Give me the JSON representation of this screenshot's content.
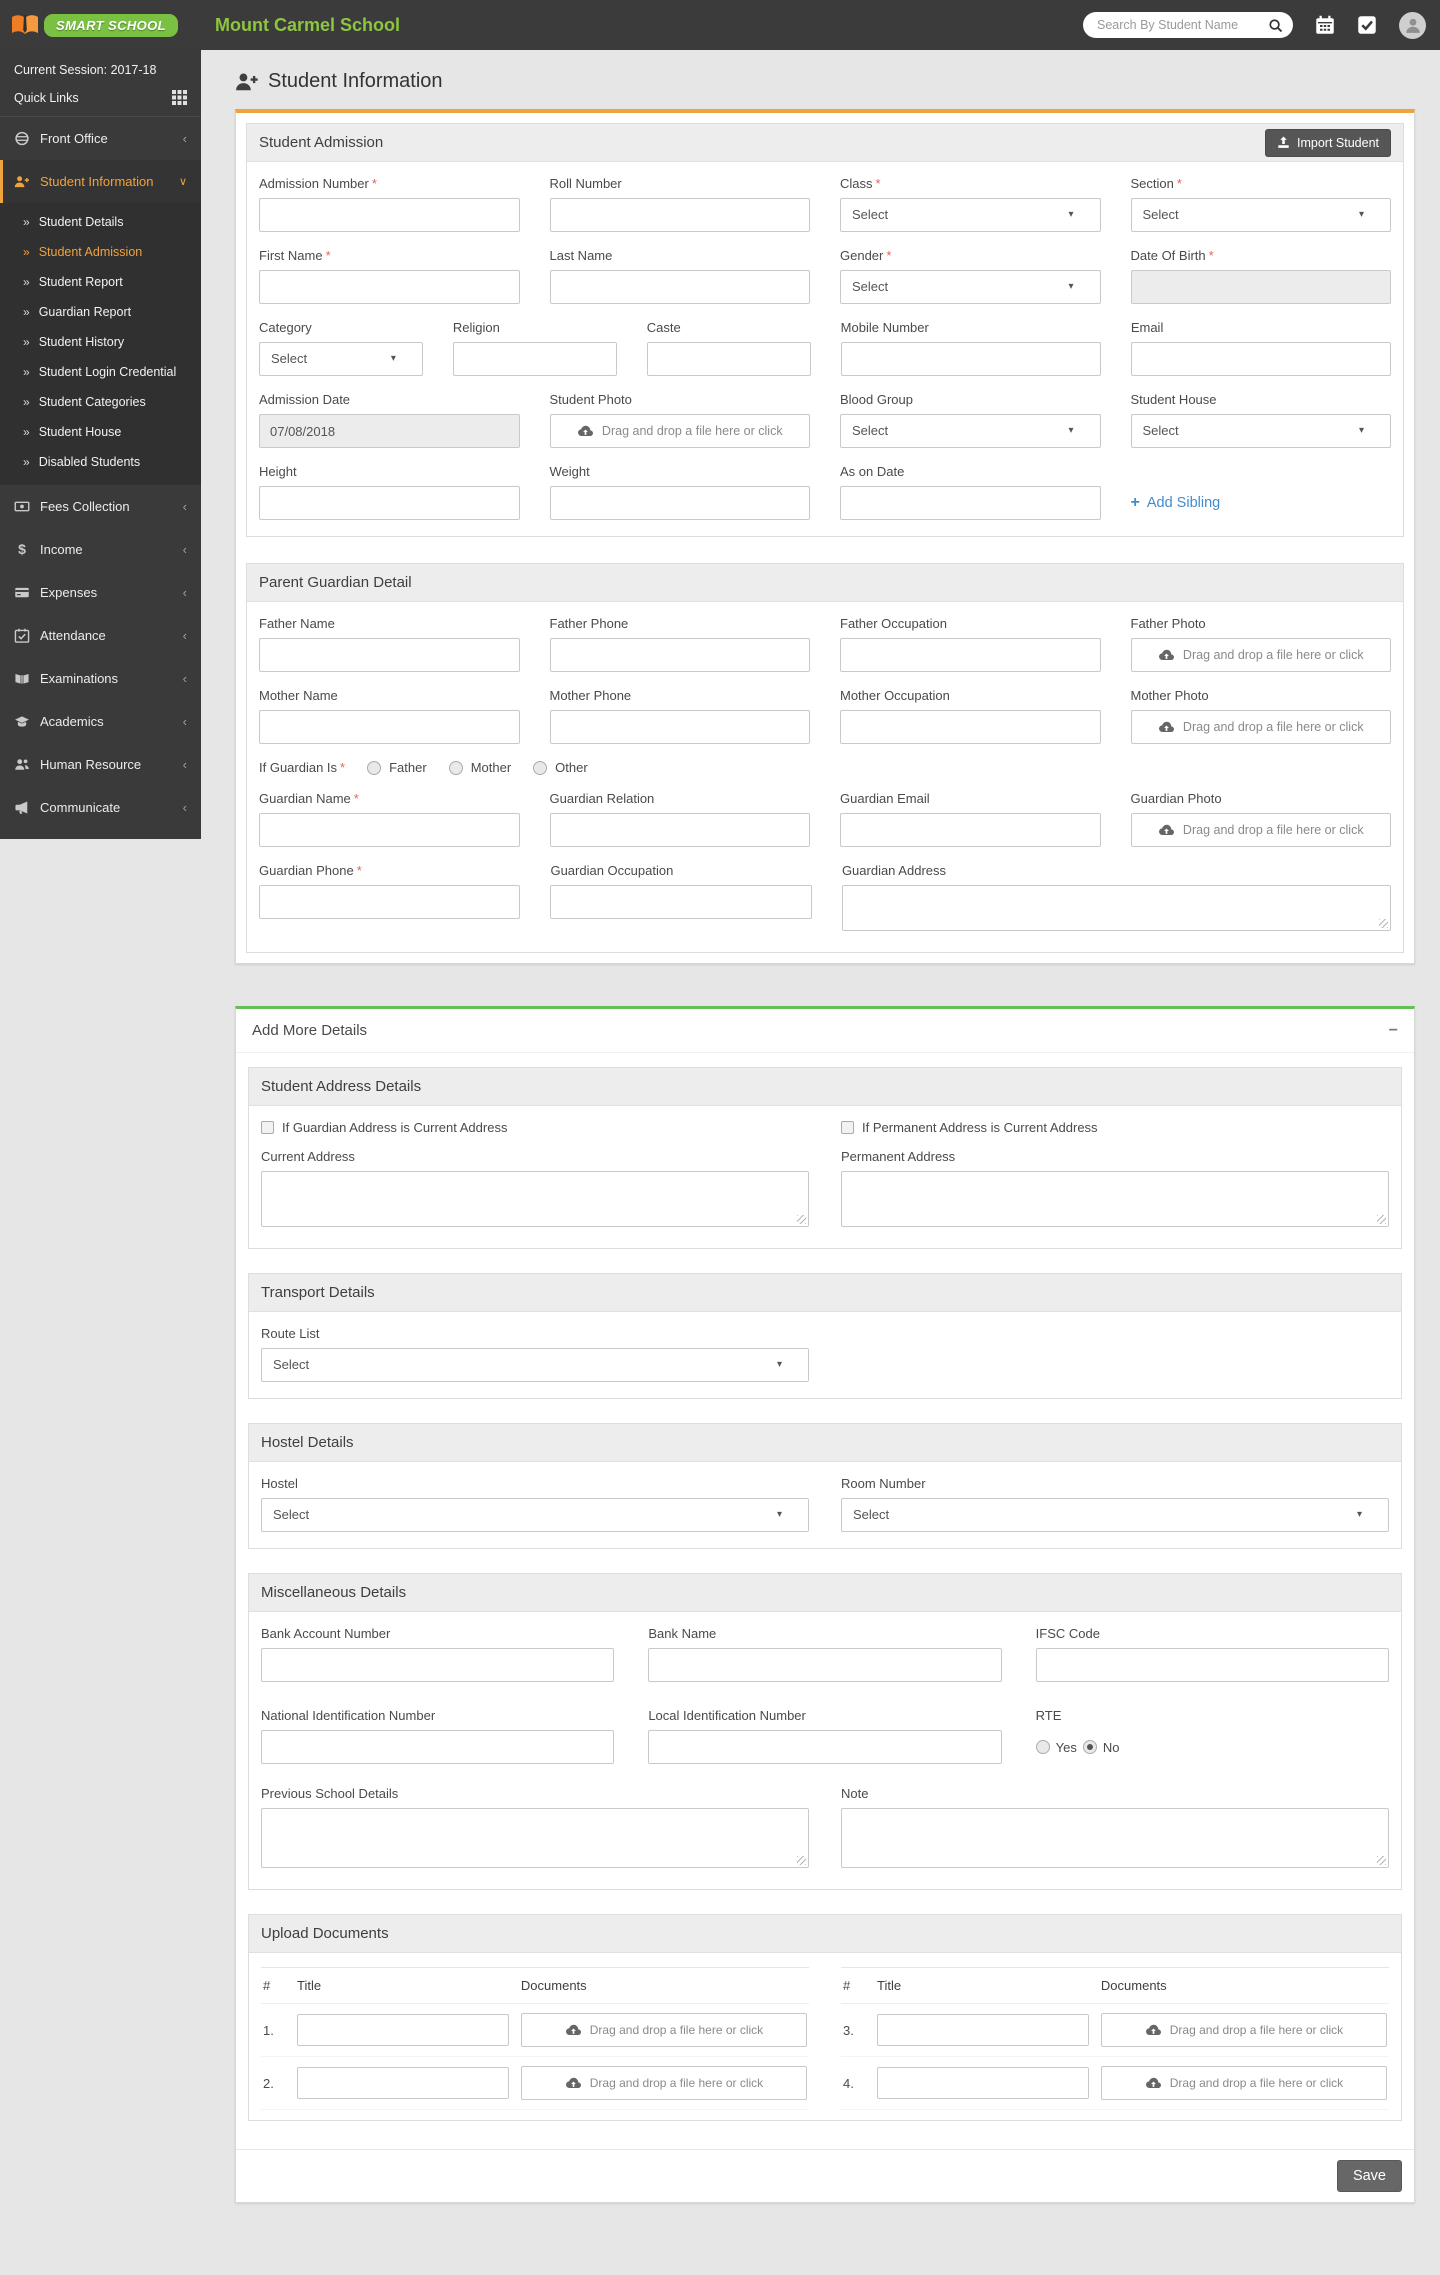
{
  "topbar": {
    "brand": "SMART SCHOOL",
    "school_name": "Mount Carmel School",
    "search_placeholder": "Search By Student Name"
  },
  "sidebar": {
    "session": "Current Session: 2017-18",
    "quick_links": "Quick Links",
    "items": [
      "Front Office",
      "Student Information",
      "Fees Collection",
      "Income",
      "Expenses",
      "Attendance",
      "Examinations",
      "Academics",
      "Human Resource",
      "Communicate"
    ],
    "sub_items": [
      "Student Details",
      "Student Admission",
      "Student Report",
      "Guardian Report",
      "Student History",
      "Student Login Credential",
      "Student Categories",
      "Student House",
      "Disabled Students"
    ],
    "active_item": "Student Information",
    "active_sub_item": "Student Admission"
  },
  "page_title": "Student Information",
  "icons": {
    "required": "*",
    "caret": "▾",
    "chevron_collapsed": "‹",
    "chevron_expanded": "∨",
    "submenu_arrow": "»",
    "collapse": "−",
    "add": "+"
  },
  "common": {
    "select_placeholder": "Select",
    "dropzone_text": "Drag and drop a file here or click"
  },
  "admission": {
    "title": "Student Admission",
    "import_label": "Import Student",
    "labels": {
      "admission_number": "Admission Number",
      "roll_number": "Roll Number",
      "class": "Class",
      "section": "Section",
      "first_name": "First Name",
      "last_name": "Last Name",
      "gender": "Gender",
      "dob": "Date Of Birth",
      "category": "Category",
      "religion": "Religion",
      "caste": "Caste",
      "mobile": "Mobile Number",
      "email": "Email",
      "admission_date": "Admission Date",
      "student_photo": "Student Photo",
      "blood_group": "Blood Group",
      "student_house": "Student House",
      "height": "Height",
      "weight": "Weight",
      "as_on_date": "As on Date",
      "add_sibling": "Add Sibling"
    },
    "values": {
      "admission_date": "07/08/2018"
    }
  },
  "guardian": {
    "title": "Parent Guardian Detail",
    "labels": {
      "father_name": "Father Name",
      "father_phone": "Father Phone",
      "father_occupation": "Father Occupation",
      "father_photo": "Father Photo",
      "mother_name": "Mother Name",
      "mother_phone": "Mother Phone",
      "mother_occupation": "Mother Occupation",
      "mother_photo": "Mother Photo",
      "if_guardian_is": "If Guardian Is",
      "father": "Father",
      "mother": "Mother",
      "other": "Other",
      "guardian_name": "Guardian Name",
      "guardian_relation": "Guardian Relation",
      "guardian_email": "Guardian Email",
      "guardian_photo": "Guardian Photo",
      "guardian_phone": "Guardian Phone",
      "guardian_occupation": "Guardian Occupation",
      "guardian_address": "Guardian Address"
    }
  },
  "more": {
    "title": "Add More Details",
    "address": {
      "title": "Student Address Details",
      "checkbox_guardian": "If Guardian Address is Current Address",
      "checkbox_permanent": "If Permanent Address is Current Address",
      "current_label": "Current Address",
      "permanent_label": "Permanent Address"
    },
    "transport": {
      "title": "Transport Details",
      "route_label": "Route List"
    },
    "hostel": {
      "title": "Hostel Details",
      "hostel_label": "Hostel",
      "room_label": "Room Number"
    },
    "misc": {
      "title": "Miscellaneous Details",
      "bank_account": "Bank Account Number",
      "bank_name": "Bank Name",
      "ifsc": "IFSC Code",
      "national_id": "National Identification Number",
      "local_id": "Local Identification Number",
      "rte": "RTE",
      "rte_yes": "Yes",
      "rte_no": "No",
      "rte_selected": "No",
      "previous_school": "Previous School Details",
      "note": "Note"
    },
    "documents": {
      "title": "Upload Documents",
      "col_hash": "#",
      "col_title": "Title",
      "col_docs": "Documents",
      "rows": [
        "1.",
        "2.",
        "3.",
        "4."
      ]
    },
    "save_label": "Save"
  },
  "colors": {
    "orange": "#f0a33c",
    "green": "#65bf55",
    "brand-green": "#7ac143",
    "name-green": "#8dc63f",
    "blue": "#428bca",
    "red": "#e06461",
    "btn-dark": "#676767"
  }
}
